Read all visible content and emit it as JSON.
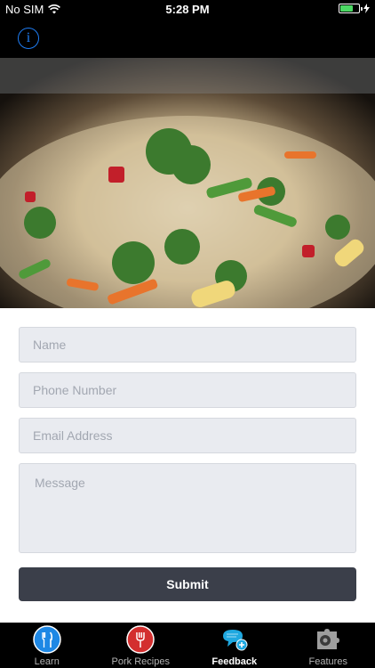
{
  "status_bar": {
    "carrier": "No SIM",
    "time": "5:28 PM",
    "battery_level": 0.7,
    "charging_icon": "bolt-icon"
  },
  "nav": {
    "info_label": "i"
  },
  "hero": {
    "icon": "fried-rice-photo"
  },
  "form": {
    "name_placeholder": "Name",
    "phone_placeholder": "Phone Number",
    "email_placeholder": "Email Address",
    "message_placeholder": "Message",
    "submit_label": "Submit"
  },
  "tabs": [
    {
      "label": "Learn",
      "icon": "cutlery-icon",
      "color": "#1e88e5"
    },
    {
      "label": "Pork Recipes",
      "icon": "fork-icon",
      "color": "#d32f2f"
    },
    {
      "label": "Feedback",
      "icon": "chat-plus-icon",
      "color": "#1fa8e0",
      "active": true
    },
    {
      "label": "Features",
      "icon": "puzzle-gear-icon",
      "color": "#9e9e9e"
    }
  ]
}
